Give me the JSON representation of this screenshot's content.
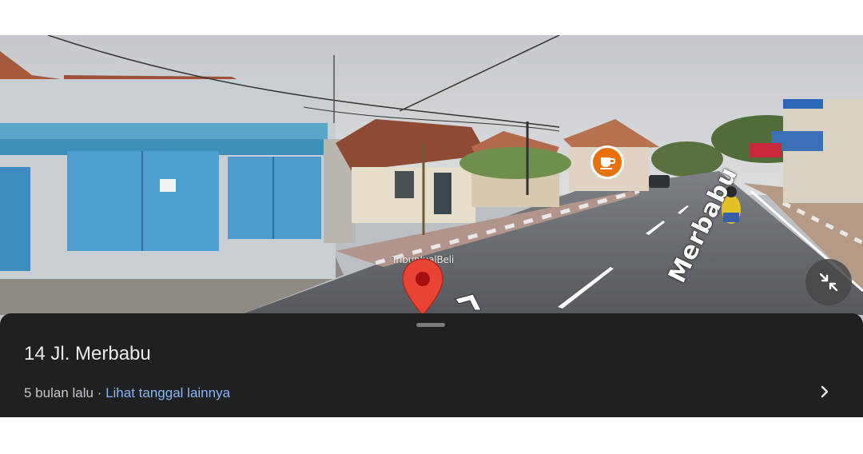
{
  "streetview": {
    "street_label": "Merbabu",
    "watermark": "TribunJualBeli",
    "icons": {
      "place_pin": "location-pin-icon",
      "cafe": "coffee-cup-icon",
      "nav": "navigation-arrow-icon",
      "exit": "exit-fullscreen-icon"
    }
  },
  "sheet": {
    "title": "14 Jl. Merbabu",
    "date": "5 bulan lalu",
    "separator": " · ",
    "more_dates_link": "Lihat tanggal lainnya",
    "chevron": "chevron-right-icon"
  },
  "colors": {
    "sheet_bg": "#1f2022",
    "link": "#8ab4f8",
    "pin": "#e94335",
    "cafe_badge": "#e8710a"
  }
}
